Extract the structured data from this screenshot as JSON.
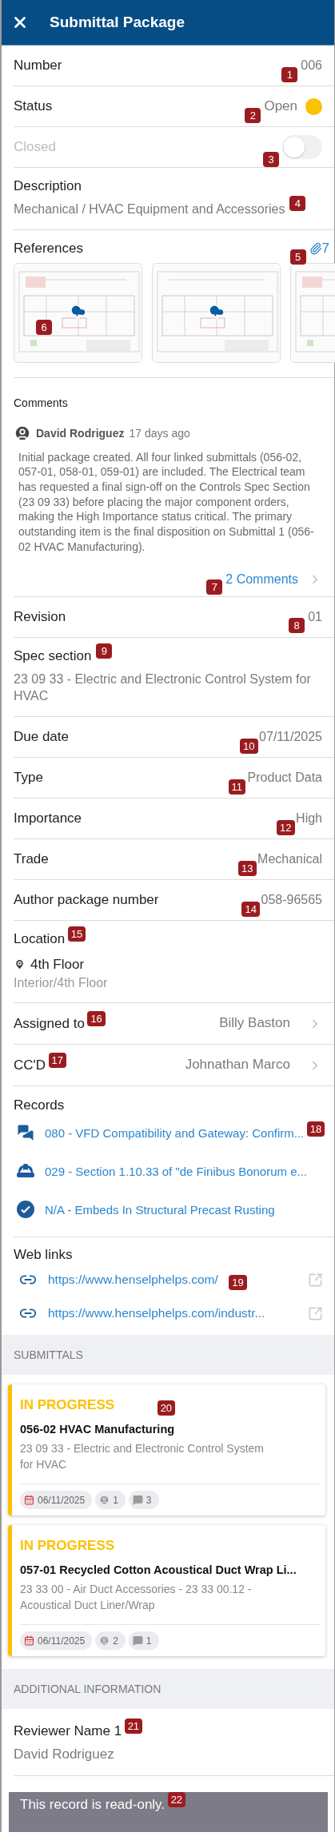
{
  "header": {
    "title": "Submittal Package"
  },
  "top_fields": [
    {
      "kind": "value",
      "label": "Number",
      "value": "006",
      "marker": "1"
    },
    {
      "kind": "status",
      "label": "Status",
      "value": "Open",
      "marker": "2"
    },
    {
      "kind": "toggle",
      "label": "Closed",
      "on": false,
      "disabled": true,
      "marker": "3"
    },
    {
      "kind": "stacked",
      "label": "Description",
      "value": "Mechanical / HVAC Equipment and Accessories",
      "marker": "4"
    }
  ],
  "references": {
    "label": "References",
    "count": "7",
    "marker": "5",
    "thumbnails": [
      {
        "kind": "picture",
        "download": true,
        "marker": "6"
      },
      {
        "kind": "picture",
        "download": true
      },
      {
        "kind": "picture"
      }
    ]
  },
  "comments": {
    "label": "Comments",
    "author": "David Rodriguez",
    "time": "17 days ago",
    "text": "Initial package created. All four linked submittals (056-02, 057-01, 058-01, 059-01) are included. The Electrical team has requested a final sign-off on the Controls Spec Section (23 09 33) before placing the major component orders, making the High Importance status critical. The primary outstanding item is the final disposition on Submittal 1 (056-02 HVAC Manufacturing).",
    "link": "2 Comments",
    "marker": "7"
  },
  "fields": [
    {
      "kind": "value",
      "label": "Revision",
      "value": "01",
      "marker": "8"
    },
    {
      "kind": "stacked",
      "label": "Spec section",
      "value": "23 09 33 - Electric and Electronic Control System for HVAC",
      "marker": "9"
    },
    {
      "kind": "value",
      "label": "Due date",
      "value": "07/11/2025",
      "marker": "10"
    },
    {
      "kind": "value",
      "label": "Type",
      "value": "Product Data",
      "marker": "11"
    },
    {
      "kind": "value",
      "label": "Importance",
      "value": "High",
      "marker": "12"
    },
    {
      "kind": "value",
      "label": "Trade",
      "value": "Mechanical",
      "marker": "13"
    },
    {
      "kind": "value",
      "label": "Author package number",
      "value": "058-96565",
      "marker": "14"
    },
    {
      "kind": "location",
      "label": "Location",
      "value": "4th Floor",
      "path": "Interior/4th Floor",
      "marker": "15"
    },
    {
      "kind": "link",
      "label": "Assigned to",
      "value": "Billy Baston",
      "marker": "16"
    },
    {
      "kind": "link",
      "label": "CC'D",
      "value": "Johnathan Marco",
      "marker": "17"
    }
  ],
  "records": {
    "label": "Records",
    "marker": "18",
    "items": [
      {
        "kind": "chat",
        "text": "080 - VFD Compatibility and Gateway: Confirm..."
      },
      {
        "kind": "hardhat",
        "text": "029 - Section 1.10.33 of \"de Finibus Bonorum e..."
      },
      {
        "kind": "check",
        "text": "N/A - Embeds In Structural Precast Rusting"
      }
    ]
  },
  "web_links": {
    "label": "Web links",
    "marker": "19",
    "items": [
      {
        "url": "https://www.henselphelps.com/"
      },
      {
        "url": "https://www.henselphelps.com/industr..."
      }
    ]
  },
  "submittals": {
    "heading": "SUBMITTALS",
    "marker": "20",
    "items": [
      {
        "status": "IN PROGRESS",
        "title": "056-02 HVAC Manufacturing",
        "spec": "23 09 33 - Electric and Electronic Control System for HVAC",
        "date": "06/11/2025",
        "people": "1",
        "comments": "3"
      },
      {
        "status": "IN PROGRESS",
        "title": "057-01 Recycled Cotton Acoustical Duct Wrap Li...",
        "spec": "23 33 00 - Air Duct Accessories - 23 33 00.12 - Acoustical Duct Liner/Wrap",
        "date": "06/11/2025",
        "people": "2",
        "comments": "1"
      }
    ]
  },
  "additional": {
    "heading": "ADDITIONAL INFORMATION",
    "fields": [
      {
        "label": "Reviewer Name 1",
        "value": "David Rodriguez",
        "marker": "21"
      }
    ]
  },
  "toast": {
    "text": "This record is read-only.",
    "marker": "22"
  }
}
